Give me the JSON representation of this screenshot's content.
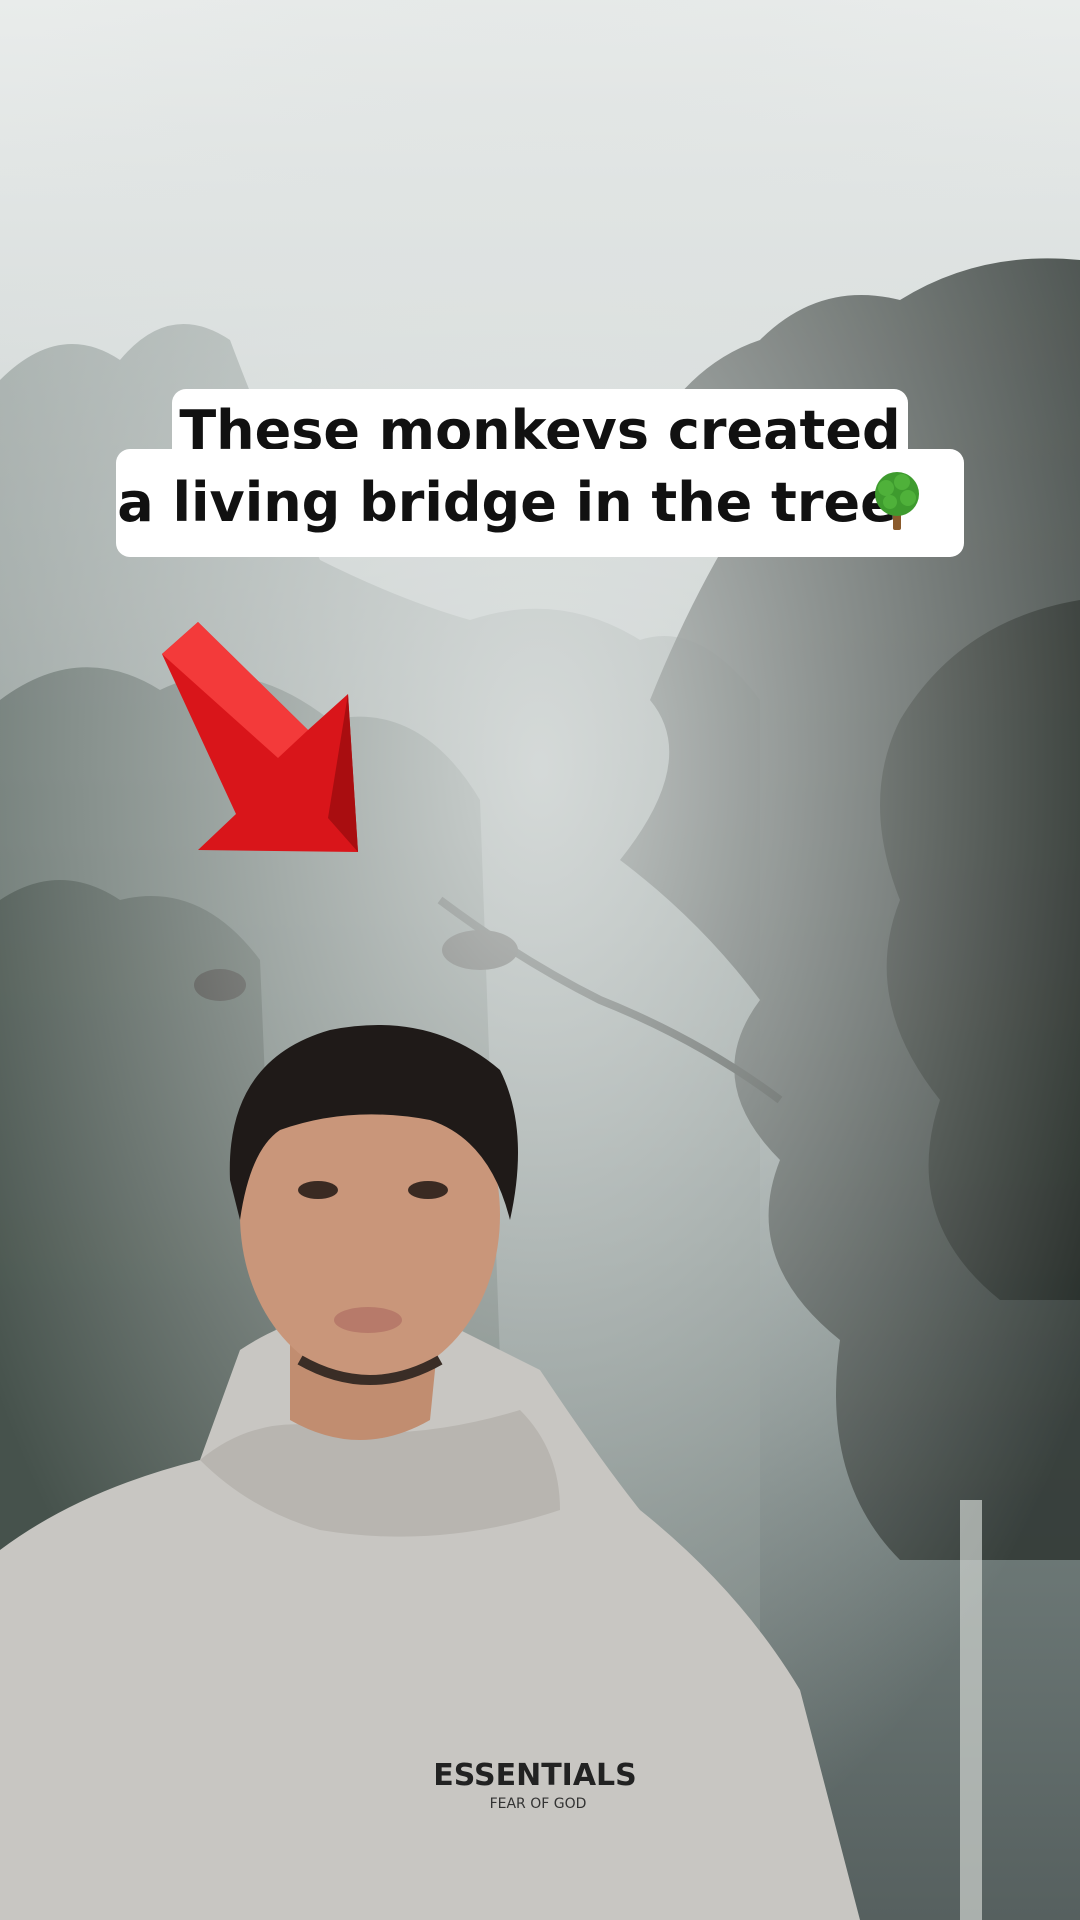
{
  "caption": {
    "line1": "These monkeys created",
    "line2": "a living bridge in the tree",
    "emoji": "tree-emoji"
  },
  "hoodie": {
    "brand": "ESSENTIALS",
    "subtext": "FEAR OF GOD"
  },
  "overlay": {
    "arrow_icon": "red-arrow-icon",
    "arrow_color": "#e0191c"
  }
}
